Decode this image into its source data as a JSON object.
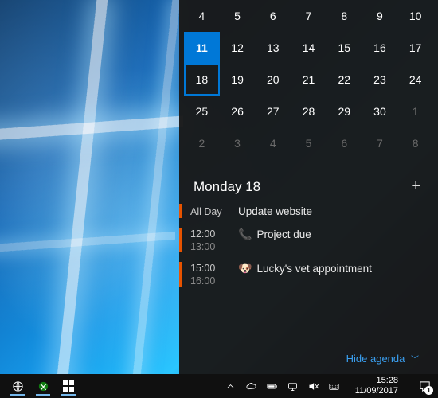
{
  "calendar": {
    "rows": [
      [
        {
          "n": "4"
        },
        {
          "n": "5"
        },
        {
          "n": "6"
        },
        {
          "n": "7"
        },
        {
          "n": "8"
        },
        {
          "n": "9"
        },
        {
          "n": "10"
        }
      ],
      [
        {
          "n": "11",
          "today": true
        },
        {
          "n": "12"
        },
        {
          "n": "13"
        },
        {
          "n": "14"
        },
        {
          "n": "15"
        },
        {
          "n": "16"
        },
        {
          "n": "17"
        }
      ],
      [
        {
          "n": "18",
          "selected": true
        },
        {
          "n": "19"
        },
        {
          "n": "20"
        },
        {
          "n": "21"
        },
        {
          "n": "22"
        },
        {
          "n": "23"
        },
        {
          "n": "24"
        }
      ],
      [
        {
          "n": "25"
        },
        {
          "n": "26"
        },
        {
          "n": "27"
        },
        {
          "n": "28"
        },
        {
          "n": "29"
        },
        {
          "n": "30"
        },
        {
          "n": "1",
          "muted": true
        }
      ],
      [
        {
          "n": "2",
          "muted": true
        },
        {
          "n": "3",
          "muted": true
        },
        {
          "n": "4",
          "muted": true
        },
        {
          "n": "5",
          "muted": true
        },
        {
          "n": "6",
          "muted": true
        },
        {
          "n": "7",
          "muted": true
        },
        {
          "n": "8",
          "muted": true
        }
      ]
    ]
  },
  "agenda": {
    "title": "Monday 18",
    "add_icon": "+",
    "events": [
      {
        "all_day": true,
        "time_label": "All Day",
        "title": "Update website",
        "icon": ""
      },
      {
        "all_day": false,
        "start": "12:00",
        "end": "13:00",
        "icon": "📞",
        "title": "Project due"
      },
      {
        "all_day": false,
        "start": "15:00",
        "end": "16:00",
        "icon": "🐶",
        "title": "Lucky's vet appointment"
      }
    ],
    "hide_label": "Hide agenda"
  },
  "taskbar": {
    "clock_time": "15:28",
    "clock_date": "11/09/2017",
    "action_center_count": "1"
  },
  "colors": {
    "accent": "#0078d7",
    "event_bar": "#e75300",
    "link": "#3a9ff0"
  }
}
